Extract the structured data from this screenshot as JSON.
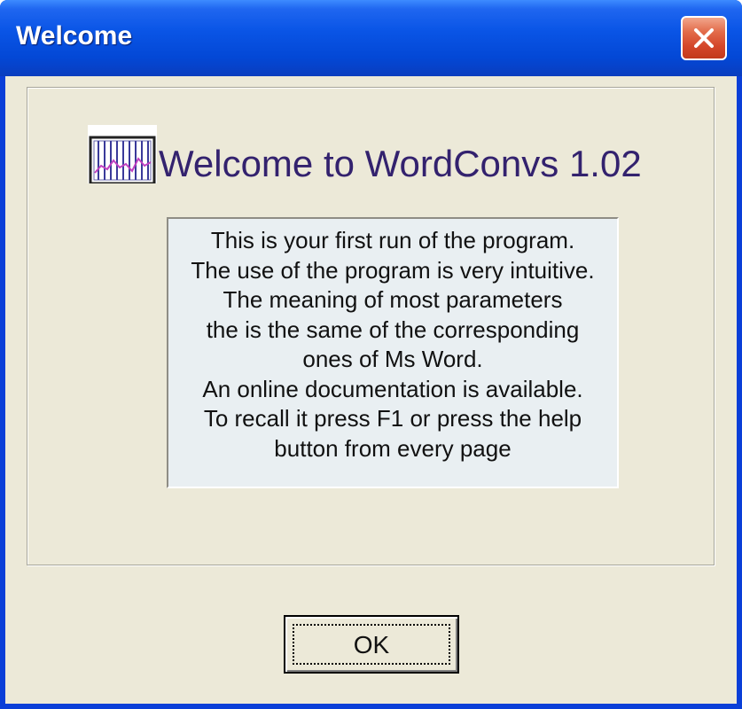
{
  "window": {
    "title": "Welcome"
  },
  "heading": "Welcome to WordConvs 1.02",
  "message": {
    "lines": [
      "This is your first run of the program.",
      "The use of the program is very intuitive.",
      "The meaning of most parameters",
      "the is the same of the corresponding",
      "ones of Ms Word.",
      "An online documentation is available.",
      "To recall it press F1 or press the help",
      "button from every page"
    ]
  },
  "buttons": {
    "ok_label": "OK"
  },
  "icons": {
    "close": "close-icon",
    "app": "app-chart-icon"
  },
  "colors": {
    "titlebar": "#0a55e6",
    "dialog_bg": "#ece9d8",
    "heading_text": "#33226e",
    "panel_bg": "#e9eff2",
    "close_button": "#d4462a"
  }
}
